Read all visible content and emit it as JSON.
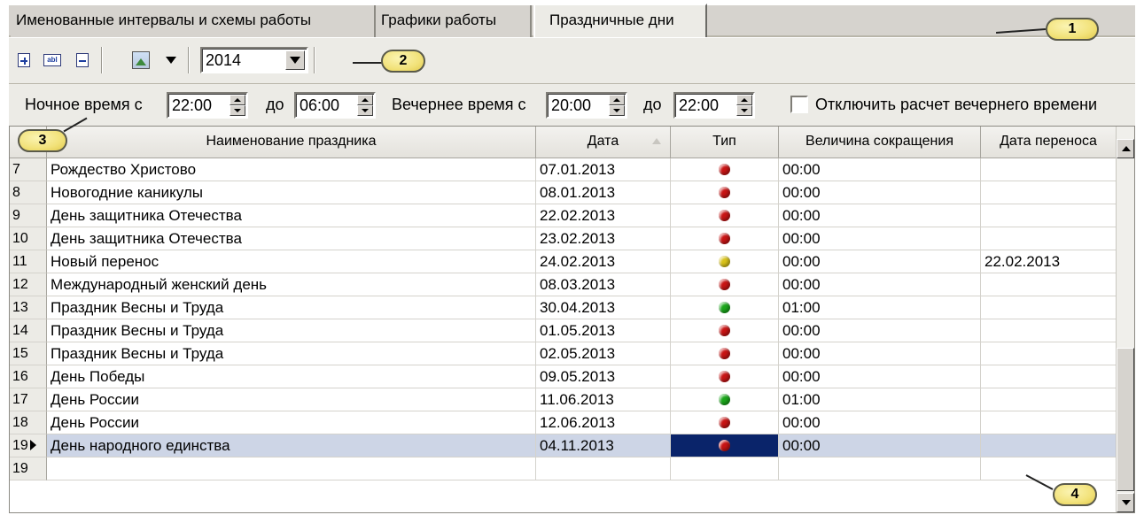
{
  "tabs": [
    {
      "label": "Именованные интервалы и схемы работы"
    },
    {
      "label": "Графики работы"
    },
    {
      "label": "Праздничные дни"
    }
  ],
  "toolbar": {
    "year": "2014",
    "icons": [
      "add-record-icon",
      "rename-icon",
      "delete-record-icon",
      "image-icon",
      "dropdown-arrow-icon"
    ]
  },
  "time_filter": {
    "night_from_label": "Ночное время с",
    "night_from": "22:00",
    "night_to_label": "до",
    "night_to": "06:00",
    "evening_from_label": "Вечернее время с",
    "evening_from": "20:00",
    "evening_to_label": "до",
    "evening_to": "22:00",
    "disable_evening_label": "Отключить расчет вечернего времени",
    "disable_evening_checked": false
  },
  "table": {
    "columns": [
      "Наименование праздника",
      "Дата",
      "Тип",
      "Величина сокращения",
      "Дата переноса"
    ],
    "rows": [
      {
        "n": "7",
        "name": "Рождество Христово",
        "date": "07.01.2013",
        "type": "red",
        "reduction": "00:00",
        "transfer": ""
      },
      {
        "n": "8",
        "name": "Новогодние каникулы",
        "date": "08.01.2013",
        "type": "red",
        "reduction": "00:00",
        "transfer": ""
      },
      {
        "n": "9",
        "name": "День защитника Отечества",
        "date": "22.02.2013",
        "type": "red",
        "reduction": "00:00",
        "transfer": ""
      },
      {
        "n": "10",
        "name": "День защитника Отечества",
        "date": "23.02.2013",
        "type": "red",
        "reduction": "00:00",
        "transfer": ""
      },
      {
        "n": "11",
        "name": "Новый перенос",
        "date": "24.02.2013",
        "type": "yellow",
        "reduction": "00:00",
        "transfer": "22.02.2013"
      },
      {
        "n": "12",
        "name": "Международный женский день",
        "date": "08.03.2013",
        "type": "red",
        "reduction": "00:00",
        "transfer": ""
      },
      {
        "n": "13",
        "name": "Праздник Весны и Труда",
        "date": "30.04.2013",
        "type": "green",
        "reduction": "01:00",
        "transfer": ""
      },
      {
        "n": "14",
        "name": "Праздник Весны и Труда",
        "date": "01.05.2013",
        "type": "red",
        "reduction": "00:00",
        "transfer": ""
      },
      {
        "n": "15",
        "name": "Праздник Весны и Труда",
        "date": "02.05.2013",
        "type": "red",
        "reduction": "00:00",
        "transfer": ""
      },
      {
        "n": "16",
        "name": "День Победы",
        "date": "09.05.2013",
        "type": "red",
        "reduction": "00:00",
        "transfer": ""
      },
      {
        "n": "17",
        "name": "День России",
        "date": "11.06.2013",
        "type": "green",
        "reduction": "01:00",
        "transfer": ""
      },
      {
        "n": "18",
        "name": "День России",
        "date": "12.06.2013",
        "type": "red",
        "reduction": "00:00",
        "transfer": ""
      },
      {
        "n": "19",
        "name": "День народного единства",
        "date": "04.11.2013",
        "type": "red",
        "reduction": "00:00",
        "transfer": "",
        "selected": true
      },
      {
        "n": "19",
        "name": "",
        "date": "",
        "type": "",
        "reduction": "",
        "transfer": ""
      }
    ]
  },
  "type_colors": {
    "red": "#c81414",
    "yellow": "#d8c21a",
    "green": "#1aa61a"
  },
  "callouts": [
    "1",
    "2",
    "3",
    "4"
  ]
}
